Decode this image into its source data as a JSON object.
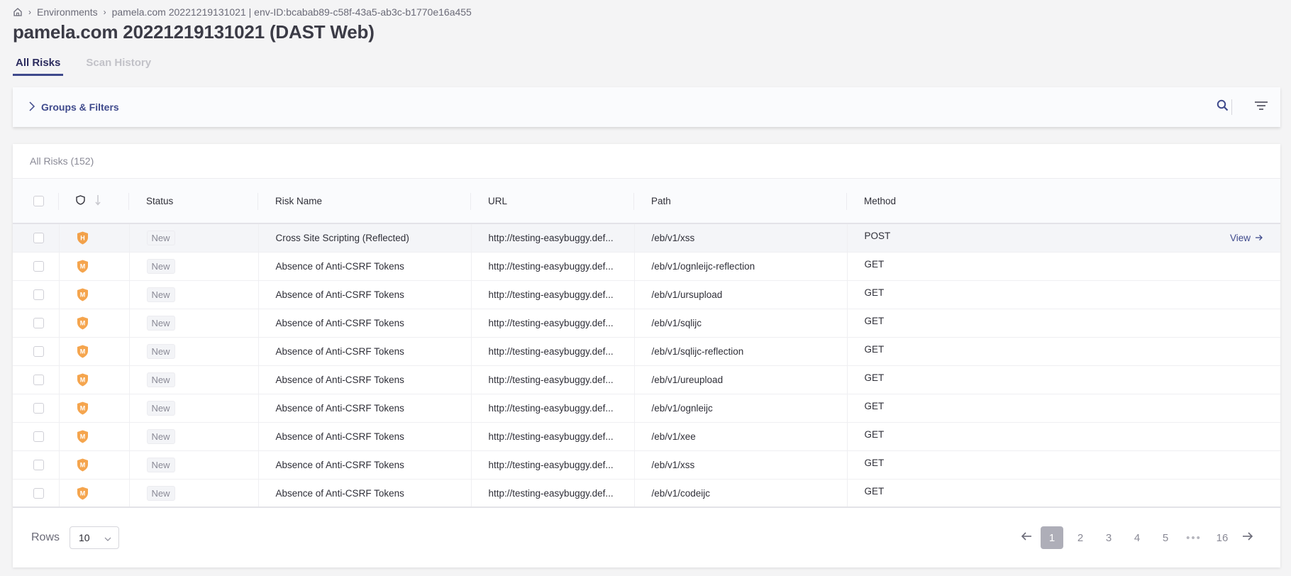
{
  "breadcrumb": {
    "home_icon": "home-icon",
    "items": [
      "Environments",
      "pamela.com 20221219131021 | env-ID:bcabab89-c58f-43a5-ab3c-b1770e16a455"
    ]
  },
  "page_title": "pamela.com 20221219131021 (DAST Web)",
  "tabs": [
    {
      "label": "All Risks",
      "active": true
    },
    {
      "label": "Scan History",
      "active": false
    }
  ],
  "filters": {
    "toggle_label": "Groups & Filters",
    "search_icon": "search-icon",
    "filter_icon": "filter-icon"
  },
  "table": {
    "title": "All Risks (152)",
    "columns": [
      "",
      "",
      "Status",
      "Risk Name",
      "URL",
      "Path",
      "Method",
      ""
    ],
    "severity_header_icon": "shield-icon",
    "sort_icon": "arrow-down-icon",
    "rows": [
      {
        "severity": "H",
        "status": "New",
        "risk_name": "Cross Site Scripting (Reflected)",
        "url": "http://testing-easybuggy.def...",
        "path": "/eb/v1/xss",
        "method": "POST",
        "action": "View"
      },
      {
        "severity": "M",
        "status": "New",
        "risk_name": "Absence of Anti-CSRF Tokens",
        "url": "http://testing-easybuggy.def...",
        "path": "/eb/v1/ognleijc-reflection",
        "method": "GET"
      },
      {
        "severity": "M",
        "status": "New",
        "risk_name": "Absence of Anti-CSRF Tokens",
        "url": "http://testing-easybuggy.def...",
        "path": "/eb/v1/ursupload",
        "method": "GET"
      },
      {
        "severity": "M",
        "status": "New",
        "risk_name": "Absence of Anti-CSRF Tokens",
        "url": "http://testing-easybuggy.def...",
        "path": "/eb/v1/sqlijc",
        "method": "GET"
      },
      {
        "severity": "M",
        "status": "New",
        "risk_name": "Absence of Anti-CSRF Tokens",
        "url": "http://testing-easybuggy.def...",
        "path": "/eb/v1/sqlijc-reflection",
        "method": "GET"
      },
      {
        "severity": "M",
        "status": "New",
        "risk_name": "Absence of Anti-CSRF Tokens",
        "url": "http://testing-easybuggy.def...",
        "path": "/eb/v1/ureupload",
        "method": "GET"
      },
      {
        "severity": "M",
        "status": "New",
        "risk_name": "Absence of Anti-CSRF Tokens",
        "url": "http://testing-easybuggy.def...",
        "path": "/eb/v1/ognleijc",
        "method": "GET"
      },
      {
        "severity": "M",
        "status": "New",
        "risk_name": "Absence of Anti-CSRF Tokens",
        "url": "http://testing-easybuggy.def...",
        "path": "/eb/v1/xee",
        "method": "GET"
      },
      {
        "severity": "M",
        "status": "New",
        "risk_name": "Absence of Anti-CSRF Tokens",
        "url": "http://testing-easybuggy.def...",
        "path": "/eb/v1/xss",
        "method": "GET"
      },
      {
        "severity": "M",
        "status": "New",
        "risk_name": "Absence of Anti-CSRF Tokens",
        "url": "http://testing-easybuggy.def...",
        "path": "/eb/v1/codeijc",
        "method": "GET"
      }
    ]
  },
  "footer": {
    "rows_label": "Rows",
    "rows_value": "10",
    "pages": [
      "1",
      "2",
      "3",
      "4",
      "5",
      "•••",
      "16"
    ],
    "current_page": "1"
  },
  "colors": {
    "accent": "#3f4a8c",
    "severity_high": "#f2a14a",
    "severity_medium": "#f5a54e",
    "active_page_bg": "#aeaeb8"
  }
}
